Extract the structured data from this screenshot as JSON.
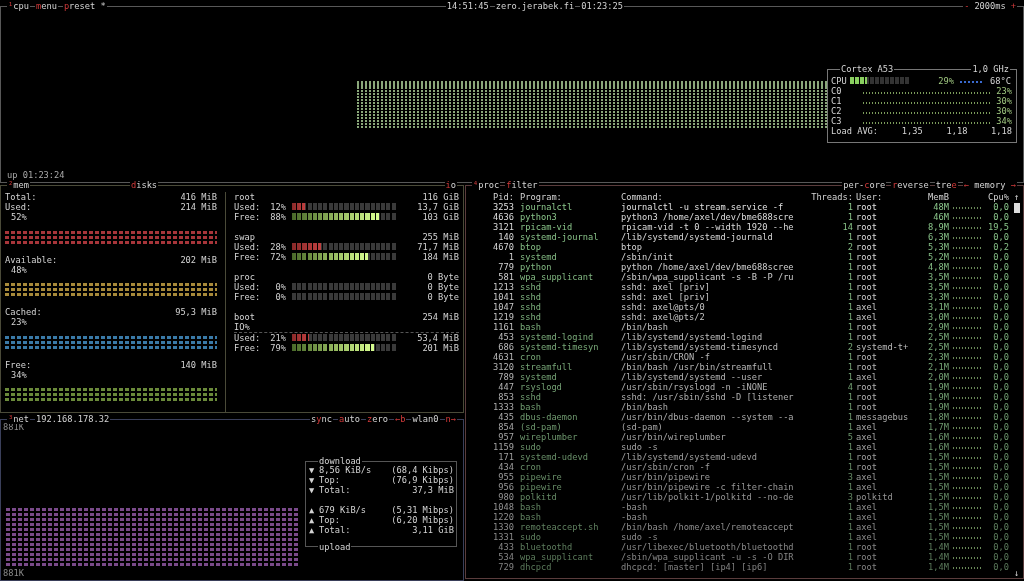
{
  "cpu": {
    "title": [
      {
        "text": "¹",
        "hotkey": true
      },
      {
        "text": "cpu",
        "hotkey": false
      }
    ],
    "menu": [
      {
        "text": "m",
        "hotkey": true
      },
      {
        "text": "enu",
        "hotkey": false
      }
    ],
    "preset": [
      {
        "text": "p",
        "hotkey": true
      },
      {
        "text": "reset *",
        "hotkey": false
      }
    ],
    "clock": "14:51:45",
    "host": "zero.jerabek.fi",
    "uptime": "01:23:25",
    "interval_down": "-",
    "interval": "2000ms",
    "interval_up": "+",
    "up_label": "up 01:23:24",
    "cortex": {
      "model": "Cortex A53",
      "freq": "1,0 GHz",
      "total": {
        "label": "CPU",
        "level": 0.29,
        "percent": "29%",
        "temp": "68°C"
      },
      "cores": [
        {
          "label": "C0",
          "percent": "23%"
        },
        {
          "label": "C1",
          "percent": "30%"
        },
        {
          "label": "C2",
          "percent": "30%"
        },
        {
          "label": "C3",
          "percent": "34%"
        }
      ],
      "load_label": "Load AVG:",
      "load": [
        "1,35",
        "1,18",
        "1,18"
      ]
    }
  },
  "mem": {
    "title": [
      {
        "text": "²",
        "hotkey": true
      },
      {
        "text": "mem",
        "hotkey": false
      }
    ],
    "items": [
      {
        "label": "Total:",
        "value": "416 MiB"
      },
      {
        "label": "Used:",
        "value": "214 MiB",
        "percent": "52%",
        "color": "#a8353a"
      },
      {
        "label": "Available:",
        "value": "202 MiB",
        "percent": "48%",
        "color": "#a88a3a"
      },
      {
        "label": "Cached:",
        "value": "95,3 MiB",
        "percent": "23%",
        "color": "#3a7aa8"
      },
      {
        "label": "Free:",
        "value": "140 MiB",
        "percent": "34%",
        "color": "#6a8a3a"
      }
    ]
  },
  "disks": {
    "title": [
      {
        "text": "d",
        "hotkey": true
      },
      {
        "text": "isks",
        "hotkey": false
      }
    ],
    "io_tab": [
      {
        "text": "i",
        "hotkey": true
      },
      {
        "text": "o",
        "hotkey": false
      }
    ],
    "items": [
      {
        "name": "root",
        "size": "116 GiB",
        "used": {
          "label": "Used:",
          "percent": "12%",
          "level": 0.12,
          "value": "13,7 GiB"
        },
        "free": {
          "label": "Free:",
          "percent": "88%",
          "level": 0.83,
          "value": "103 GiB"
        }
      },
      {
        "name": "swap",
        "size": "255 MiB",
        "used": {
          "label": "Used:",
          "percent": "28%",
          "level": 0.28,
          "value": "71,7 MiB"
        },
        "free": {
          "label": "Free:",
          "percent": "72%",
          "level": 0.72,
          "value": "184 MiB"
        }
      },
      {
        "name": "proc",
        "size": "0 Byte",
        "used": {
          "label": "Used:",
          "percent": "0%",
          "level": 0,
          "value": "0 Byte"
        },
        "free": {
          "label": "Free:",
          "percent": "0%",
          "level": 0,
          "value": "0 Byte"
        }
      },
      {
        "name": "boot",
        "size": "254 MiB",
        "io_label": "IO%",
        "used": {
          "label": "Used:",
          "percent": "21%",
          "level": 0.16,
          "value": "53,4 MiB"
        },
        "free": {
          "label": "Free:",
          "percent": "79%",
          "level": 0.78,
          "value": "201 MiB"
        }
      }
    ]
  },
  "net": {
    "title": [
      {
        "text": "³",
        "hotkey": true
      },
      {
        "text": "net",
        "hotkey": false
      }
    ],
    "address": "192.168.178.32",
    "options": [
      [
        {
          "text": "s",
          "hotkey": false
        },
        {
          "text": "y",
          "hotkey": true
        },
        {
          "text": "nc",
          "hotkey": false
        }
      ],
      [
        {
          "text": "a",
          "hotkey": true
        },
        {
          "text": "uto",
          "hotkey": false
        }
      ],
      [
        {
          "text": "z",
          "hotkey": true
        },
        {
          "text": "ero",
          "hotkey": false
        }
      ]
    ],
    "prev": "←b",
    "interface": "wlan0",
    "next": "n→",
    "scale_top": "881K",
    "scale_bottom": "881K",
    "download": {
      "title": "download",
      "rows": [
        {
          "arrow": "▼",
          "label": "8,56 KiB/s",
          "value": "(68,4 Kibps)"
        },
        {
          "arrow": "▼",
          "label": "Top:",
          "value": "(76,9 Kibps)"
        },
        {
          "arrow": "▼",
          "label": "Total:",
          "value": "37,3 MiB"
        }
      ]
    },
    "upload": {
      "title": "upload",
      "rows": [
        {
          "arrow": "▲",
          "label": "679 KiB/s",
          "value": "(5,31 Mibps)"
        },
        {
          "arrow": "▲",
          "label": "Top:",
          "value": "(6,20 Mibps)"
        },
        {
          "arrow": "▲",
          "label": "Total:",
          "value": "3,11 GiB"
        }
      ]
    }
  },
  "proc": {
    "title": [
      {
        "text": "⁴",
        "hotkey": true
      },
      {
        "text": "proc",
        "hotkey": false
      }
    ],
    "filter": [
      {
        "text": "f",
        "hotkey": true
      },
      {
        "text": "ilter",
        "hotkey": false
      }
    ],
    "options": [
      [
        {
          "text": "per-",
          "hotkey": false
        },
        {
          "text": "c",
          "hotkey": true
        },
        {
          "text": "ore",
          "hotkey": false
        }
      ],
      [
        {
          "text": "r",
          "hotkey": true
        },
        {
          "text": "everse",
          "hotkey": false
        }
      ],
      [
        {
          "text": "tre",
          "hotkey": false
        },
        {
          "text": "e",
          "hotkey": true
        }
      ]
    ],
    "sort": [
      {
        "text": "←",
        "hotkey": true
      },
      {
        "text": " memory ",
        "hotkey": false
      },
      {
        "text": "→",
        "hotkey": true
      }
    ],
    "columns": [
      "Pid:",
      "Program:",
      "Command:",
      "Threads:",
      "User:",
      "MemB",
      "Cpu%"
    ],
    "scroll_up": "↑",
    "scroll_down": "↓",
    "rows": [
      {
        "pid": "3253",
        "program": "journalctl",
        "command": "journalctl -u stream.service -f",
        "threads": "1",
        "user": "root",
        "memb": "48M",
        "cpu": "0,0"
      },
      {
        "pid": "4636",
        "program": "python3",
        "command": "python3 /home/axel/dev/bme688scre",
        "threads": "1",
        "user": "root",
        "memb": "46M",
        "cpu": "0,0"
      },
      {
        "pid": "3121",
        "program": "rpicam-vid",
        "command": "rpicam-vid -t 0 --width 1920 --he",
        "threads": "14",
        "user": "root",
        "memb": "8,9M",
        "cpu": "19,5"
      },
      {
        "pid": "140",
        "program": "systemd-journal",
        "command": "/lib/systemd/systemd-journald",
        "threads": "1",
        "user": "root",
        "memb": "6,3M",
        "cpu": "0,0"
      },
      {
        "pid": "4670",
        "program": "btop",
        "command": "btop",
        "threads": "2",
        "user": "root",
        "memb": "5,3M",
        "cpu": "0,2"
      },
      {
        "pid": "1",
        "program": "systemd",
        "command": "/sbin/init",
        "threads": "1",
        "user": "root",
        "memb": "5,2M",
        "cpu": "0,0"
      },
      {
        "pid": "779",
        "program": "python",
        "command": "python /home/axel/dev/bme688scree",
        "threads": "1",
        "user": "root",
        "memb": "4,8M",
        "cpu": "0,0"
      },
      {
        "pid": "581",
        "program": "wpa_supplicant",
        "command": "/sbin/wpa_supplicant -s -B -P /ru",
        "threads": "1",
        "user": "root",
        "memb": "3,5M",
        "cpu": "0,0"
      },
      {
        "pid": "1213",
        "program": "sshd",
        "command": "sshd: axel [priv]",
        "threads": "1",
        "user": "root",
        "memb": "3,5M",
        "cpu": "0,0"
      },
      {
        "pid": "1041",
        "program": "sshd",
        "command": "sshd: axel [priv]",
        "threads": "1",
        "user": "root",
        "memb": "3,3M",
        "cpu": "0,0"
      },
      {
        "pid": "1047",
        "program": "sshd",
        "command": "sshd: axel@pts/0",
        "threads": "1",
        "user": "axel",
        "memb": "3,1M",
        "cpu": "0,0"
      },
      {
        "pid": "1219",
        "program": "sshd",
        "command": "sshd: axel@pts/2",
        "threads": "1",
        "user": "axel",
        "memb": "3,0M",
        "cpu": "0,0"
      },
      {
        "pid": "1161",
        "program": "bash",
        "command": "/bin/bash",
        "threads": "1",
        "user": "root",
        "memb": "2,9M",
        "cpu": "0,0"
      },
      {
        "pid": "453",
        "program": "systemd-logind",
        "command": "/lib/systemd/systemd-logind",
        "threads": "1",
        "user": "root",
        "memb": "2,5M",
        "cpu": "0,0"
      },
      {
        "pid": "686",
        "program": "systemd-timesyn",
        "command": "/lib/systemd/systemd-timesyncd",
        "threads": "2",
        "user": "systemd-t+",
        "memb": "2,5M",
        "cpu": "0,0"
      },
      {
        "pid": "4631",
        "program": "cron",
        "command": "/usr/sbin/CRON -f",
        "threads": "1",
        "user": "root",
        "memb": "2,3M",
        "cpu": "0,0"
      },
      {
        "pid": "3120",
        "program": "streamfull",
        "command": "/bin/bash /usr/bin/streamfull",
        "threads": "1",
        "user": "root",
        "memb": "2,1M",
        "cpu": "0,0"
      },
      {
        "pid": "789",
        "program": "systemd",
        "command": "/lib/systemd/systemd --user",
        "threads": "1",
        "user": "axel",
        "memb": "2,0M",
        "cpu": "0,0"
      },
      {
        "pid": "447",
        "program": "rsyslogd",
        "command": "/usr/sbin/rsyslogd -n -iNONE",
        "threads": "4",
        "user": "root",
        "memb": "1,9M",
        "cpu": "0,0"
      },
      {
        "pid": "853",
        "program": "sshd",
        "command": "sshd: /usr/sbin/sshd -D [listener",
        "threads": "1",
        "user": "root",
        "memb": "1,9M",
        "cpu": "0,0"
      },
      {
        "pid": "1333",
        "program": "bash",
        "command": "/bin/bash",
        "threads": "1",
        "user": "root",
        "memb": "1,9M",
        "cpu": "0,0"
      },
      {
        "pid": "435",
        "program": "dbus-daemon",
        "command": "/usr/bin/dbus-daemon --system --a",
        "threads": "1",
        "user": "messagebus",
        "memb": "1,8M",
        "cpu": "0,0"
      },
      {
        "pid": "854",
        "program": "(sd-pam)",
        "command": "(sd-pam)",
        "threads": "1",
        "user": "axel",
        "memb": "1,7M",
        "cpu": "0,0"
      },
      {
        "pid": "957",
        "program": "wireplumber",
        "command": "/usr/bin/wireplumber",
        "threads": "5",
        "user": "axel",
        "memb": "1,6M",
        "cpu": "0,0"
      },
      {
        "pid": "1159",
        "program": "sudo",
        "command": "sudo -s",
        "threads": "1",
        "user": "axel",
        "memb": "1,6M",
        "cpu": "0,0"
      },
      {
        "pid": "171",
        "program": "systemd-udevd",
        "command": "/lib/systemd/systemd-udevd",
        "threads": "1",
        "user": "root",
        "memb": "1,5M",
        "cpu": "0,0"
      },
      {
        "pid": "434",
        "program": "cron",
        "command": "/usr/sbin/cron -f",
        "threads": "1",
        "user": "root",
        "memb": "1,5M",
        "cpu": "0,0"
      },
      {
        "pid": "955",
        "program": "pipewire",
        "command": "/usr/bin/pipewire",
        "threads": "3",
        "user": "axel",
        "memb": "1,5M",
        "cpu": "0,0"
      },
      {
        "pid": "956",
        "program": "pipewire",
        "command": "/usr/bin/pipewire -c filter-chain",
        "threads": "1",
        "user": "axel",
        "memb": "1,5M",
        "cpu": "0,0"
      },
      {
        "pid": "980",
        "program": "polkitd",
        "command": "/usr/lib/polkit-1/polkitd --no-de",
        "threads": "3",
        "user": "polkitd",
        "memb": "1,5M",
        "cpu": "0,0"
      },
      {
        "pid": "1048",
        "program": "bash",
        "command": "-bash",
        "threads": "1",
        "user": "axel",
        "memb": "1,5M",
        "cpu": "0,0"
      },
      {
        "pid": "1220",
        "program": "bash",
        "command": "-bash",
        "threads": "1",
        "user": "axel",
        "memb": "1,5M",
        "cpu": "0,0"
      },
      {
        "pid": "1330",
        "program": "remoteaccept.sh",
        "command": "/bin/bash /home/axel/remoteaccept",
        "threads": "1",
        "user": "axel",
        "memb": "1,5M",
        "cpu": "0,0"
      },
      {
        "pid": "1331",
        "program": "sudo",
        "command": "sudo -s",
        "threads": "1",
        "user": "axel",
        "memb": "1,5M",
        "cpu": "0,0"
      },
      {
        "pid": "433",
        "program": "bluetoothd",
        "command": "/usr/libexec/bluetooth/bluetoothd",
        "threads": "1",
        "user": "root",
        "memb": "1,4M",
        "cpu": "0,0"
      },
      {
        "pid": "534",
        "program": "wpa_supplicant",
        "command": "/sbin/wpa_supplicant -u -s -O DIR",
        "threads": "1",
        "user": "root",
        "memb": "1,4M",
        "cpu": "0,0"
      },
      {
        "pid": "729",
        "program": "dhcpcd",
        "command": "dhcpcd: [master] [ip4] [ip6]",
        "threads": "1",
        "user": "root",
        "memb": "1,4M",
        "cpu": "0,0"
      }
    ]
  }
}
